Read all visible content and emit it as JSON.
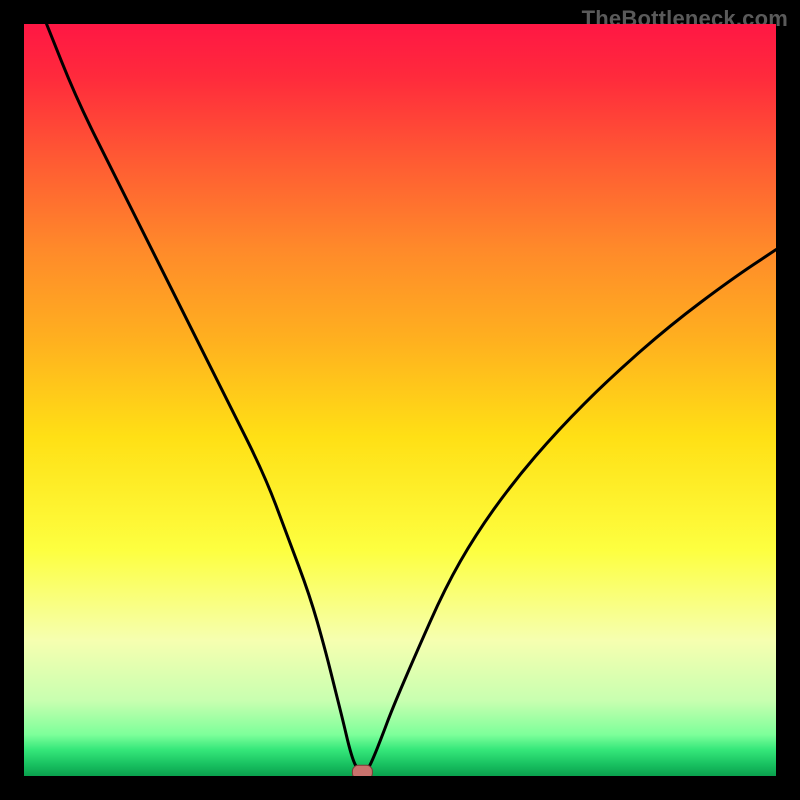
{
  "watermark": "TheBottleneck.com",
  "chart_data": {
    "type": "line",
    "title": "",
    "xlabel": "",
    "ylabel": "",
    "xlim": [
      0,
      100
    ],
    "ylim": [
      0,
      100
    ],
    "x": [
      3,
      7,
      12,
      17,
      22,
      27,
      32,
      35,
      38,
      40,
      41.5,
      42.5,
      43.2,
      43.8,
      44.3,
      44.8,
      45.2,
      45.8,
      46.5,
      47.5,
      49,
      52,
      56,
      60,
      65,
      71,
      78,
      86,
      94,
      100
    ],
    "values": [
      100,
      90,
      80,
      70,
      60,
      50,
      40,
      32,
      24,
      17,
      11,
      7,
      4,
      2,
      1,
      0.5,
      0.5,
      1,
      2.5,
      5,
      9,
      16,
      25,
      32,
      39,
      46,
      53,
      60,
      66,
      70
    ],
    "optimum_x": 45,
    "marker": {
      "x": 45,
      "y": 0.5
    },
    "gradient_stops": [
      {
        "offset": 0.0,
        "color": "#ff1744"
      },
      {
        "offset": 0.07,
        "color": "#ff2a3c"
      },
      {
        "offset": 0.18,
        "color": "#ff5a33"
      },
      {
        "offset": 0.3,
        "color": "#ff8a2a"
      },
      {
        "offset": 0.42,
        "color": "#ffb01f"
      },
      {
        "offset": 0.55,
        "color": "#ffe015"
      },
      {
        "offset": 0.7,
        "color": "#fdff40"
      },
      {
        "offset": 0.82,
        "color": "#f6ffb0"
      },
      {
        "offset": 0.9,
        "color": "#c8ffb0"
      },
      {
        "offset": 0.945,
        "color": "#7dff9a"
      },
      {
        "offset": 0.965,
        "color": "#35e77a"
      },
      {
        "offset": 0.985,
        "color": "#18c060"
      },
      {
        "offset": 1.0,
        "color": "#0aa04d"
      }
    ]
  }
}
